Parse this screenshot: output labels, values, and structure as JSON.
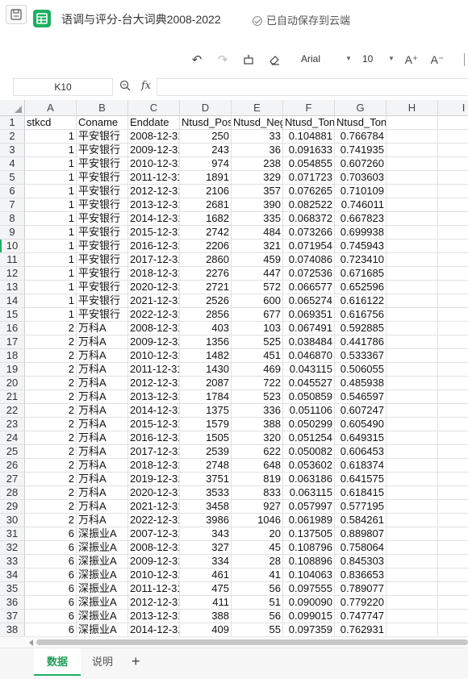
{
  "title_bar": {
    "doc_title": "语调与评分-台大词典2008-2022",
    "cloud_status": "已自动保存到云端"
  },
  "toolbar": {
    "font_name": "Arial",
    "font_size": "10",
    "increase_font_label": "A⁺",
    "decrease_font_label": "A⁻"
  },
  "formula_bar": {
    "cell_ref": "K10",
    "fx_label": "fx",
    "value": ""
  },
  "grid": {
    "columns": [
      "A",
      "B",
      "C",
      "D",
      "E",
      "F",
      "G",
      "H",
      "I"
    ],
    "active_row": 10,
    "rows": [
      {
        "n": "1",
        "c": [
          "stkcd",
          "Coname",
          "Enddate",
          "Ntusd_Pos",
          "Ntusd_Neg",
          "Ntusd_Tone",
          "Ntusd_Tone2"
        ]
      },
      {
        "n": "2",
        "c": [
          "1",
          "平安银行",
          "2008-12-31",
          "250",
          "33",
          "0.104881",
          "0.766784"
        ]
      },
      {
        "n": "3",
        "c": [
          "1",
          "平安银行",
          "2009-12-31",
          "243",
          "36",
          "0.091633",
          "0.741935"
        ]
      },
      {
        "n": "4",
        "c": [
          "1",
          "平安银行",
          "2010-12-31",
          "974",
          "238",
          "0.054855",
          "0.607260"
        ]
      },
      {
        "n": "5",
        "c": [
          "1",
          "平安银行",
          "2011-12-31",
          "1891",
          "329",
          "0.071723",
          "0.703603"
        ]
      },
      {
        "n": "6",
        "c": [
          "1",
          "平安银行",
          "2012-12-31",
          "2106",
          "357",
          "0.076265",
          "0.710109"
        ]
      },
      {
        "n": "7",
        "c": [
          "1",
          "平安银行",
          "2013-12-31",
          "2681",
          "390",
          "0.082522",
          "0.746011"
        ]
      },
      {
        "n": "8",
        "c": [
          "1",
          "平安银行",
          "2014-12-31",
          "1682",
          "335",
          "0.068372",
          "0.667823"
        ]
      },
      {
        "n": "9",
        "c": [
          "1",
          "平安银行",
          "2015-12-31",
          "2742",
          "484",
          "0.073266",
          "0.699938"
        ]
      },
      {
        "n": "10",
        "c": [
          "1",
          "平安银行",
          "2016-12-31",
          "2206",
          "321",
          "0.071954",
          "0.745943"
        ]
      },
      {
        "n": "11",
        "c": [
          "1",
          "平安银行",
          "2017-12-31",
          "2860",
          "459",
          "0.074086",
          "0.723410"
        ]
      },
      {
        "n": "12",
        "c": [
          "1",
          "平安银行",
          "2018-12-31",
          "2276",
          "447",
          "0.072536",
          "0.671685"
        ]
      },
      {
        "n": "13",
        "c": [
          "1",
          "平安银行",
          "2020-12-31",
          "2721",
          "572",
          "0.066577",
          "0.652596"
        ]
      },
      {
        "n": "14",
        "c": [
          "1",
          "平安银行",
          "2021-12-31",
          "2526",
          "600",
          "0.065274",
          "0.616122"
        ]
      },
      {
        "n": "15",
        "c": [
          "1",
          "平安银行",
          "2022-12-31",
          "2856",
          "677",
          "0.069351",
          "0.616756"
        ]
      },
      {
        "n": "16",
        "c": [
          "2",
          "万科A",
          "2008-12-31",
          "403",
          "103",
          "0.067491",
          "0.592885"
        ]
      },
      {
        "n": "17",
        "c": [
          "2",
          "万科A",
          "2009-12-31",
          "1356",
          "525",
          "0.038484",
          "0.441786"
        ]
      },
      {
        "n": "18",
        "c": [
          "2",
          "万科A",
          "2010-12-31",
          "1482",
          "451",
          "0.046870",
          "0.533367"
        ]
      },
      {
        "n": "19",
        "c": [
          "2",
          "万科A",
          "2011-12-31",
          "1430",
          "469",
          "0.043115",
          "0.506055"
        ]
      },
      {
        "n": "20",
        "c": [
          "2",
          "万科A",
          "2012-12-31",
          "2087",
          "722",
          "0.045527",
          "0.485938"
        ]
      },
      {
        "n": "21",
        "c": [
          "2",
          "万科A",
          "2013-12-31",
          "1784",
          "523",
          "0.050859",
          "0.546597"
        ]
      },
      {
        "n": "22",
        "c": [
          "2",
          "万科A",
          "2014-12-31",
          "1375",
          "336",
          "0.051106",
          "0.607247"
        ]
      },
      {
        "n": "23",
        "c": [
          "2",
          "万科A",
          "2015-12-31",
          "1579",
          "388",
          "0.050299",
          "0.605490"
        ]
      },
      {
        "n": "24",
        "c": [
          "2",
          "万科A",
          "2016-12-31",
          "1505",
          "320",
          "0.051254",
          "0.649315"
        ]
      },
      {
        "n": "25",
        "c": [
          "2",
          "万科A",
          "2017-12-31",
          "2539",
          "622",
          "0.050082",
          "0.606453"
        ]
      },
      {
        "n": "26",
        "c": [
          "2",
          "万科A",
          "2018-12-31",
          "2748",
          "648",
          "0.053602",
          "0.618374"
        ]
      },
      {
        "n": "27",
        "c": [
          "2",
          "万科A",
          "2019-12-31",
          "3751",
          "819",
          "0.063186",
          "0.641575"
        ]
      },
      {
        "n": "28",
        "c": [
          "2",
          "万科A",
          "2020-12-31",
          "3533",
          "833",
          "0.063115",
          "0.618415"
        ]
      },
      {
        "n": "29",
        "c": [
          "2",
          "万科A",
          "2021-12-31",
          "3458",
          "927",
          "0.057997",
          "0.577195"
        ]
      },
      {
        "n": "30",
        "c": [
          "2",
          "万科A",
          "2022-12-31",
          "3986",
          "1046",
          "0.061989",
          "0.584261"
        ]
      },
      {
        "n": "31",
        "c": [
          "6",
          "深振业A",
          "2007-12-31",
          "343",
          "20",
          "0.137505",
          "0.889807"
        ]
      },
      {
        "n": "32",
        "c": [
          "6",
          "深振业A",
          "2008-12-31",
          "327",
          "45",
          "0.108796",
          "0.758064"
        ]
      },
      {
        "n": "33",
        "c": [
          "6",
          "深振业A",
          "2009-12-31",
          "334",
          "28",
          "0.108896",
          "0.845303"
        ]
      },
      {
        "n": "34",
        "c": [
          "6",
          "深振业A",
          "2010-12-31",
          "461",
          "41",
          "0.104063",
          "0.836653"
        ]
      },
      {
        "n": "35",
        "c": [
          "6",
          "深振业A",
          "2011-12-31",
          "475",
          "56",
          "0.097555",
          "0.789077"
        ]
      },
      {
        "n": "36",
        "c": [
          "6",
          "深振业A",
          "2012-12-31",
          "411",
          "51",
          "0.090090",
          "0.779220"
        ]
      },
      {
        "n": "37",
        "c": [
          "6",
          "深振业A",
          "2013-12-31",
          "388",
          "56",
          "0.099015",
          "0.747747"
        ]
      },
      {
        "n": "38",
        "c": [
          "6",
          "深振业A",
          "2014-12-31",
          "409",
          "55",
          "0.097359",
          "0.762931"
        ]
      }
    ]
  },
  "sheet_tabs": {
    "tabs": [
      {
        "label": "数据",
        "active": true
      },
      {
        "label": "说明",
        "active": false
      }
    ],
    "add_label": "+"
  },
  "colors": {
    "accent": "#1eaf62",
    "active_tab_text": "#1e9e57",
    "header_bg": "#f3f4f6",
    "gridline": "#e1e1e1"
  },
  "icons": [
    "save-icon",
    "sheets-app-icon",
    "cloud-check-icon",
    "undo-icon",
    "redo-icon",
    "format-painter-icon",
    "eraser-icon",
    "zoom-icon",
    "fx-icon"
  ]
}
